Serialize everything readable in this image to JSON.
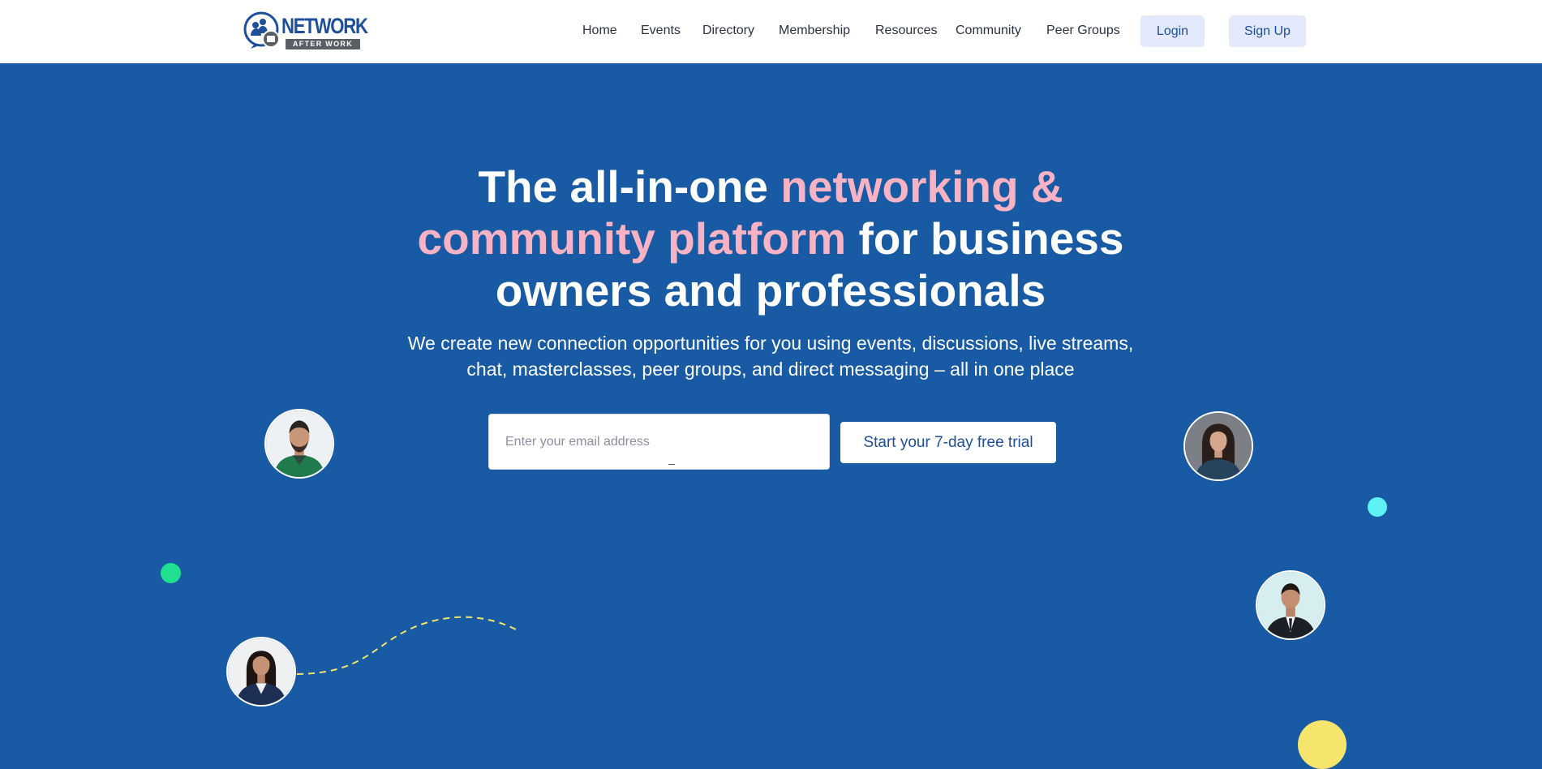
{
  "header": {
    "logo": {
      "name": "logo-network-after-work",
      "word": "NETWORK",
      "sub": "AFTER WORK"
    },
    "nav": [
      {
        "label": "Home"
      },
      {
        "label": "Events"
      },
      {
        "label": "Directory"
      },
      {
        "label": "Membership"
      },
      {
        "label": "Resources"
      },
      {
        "label": "Community"
      },
      {
        "label": "Peer Groups"
      }
    ],
    "login_label": "Login",
    "signup_label": "Sign Up"
  },
  "hero": {
    "title_part1": "The all-in-one ",
    "title_accent": "networking & community platform",
    "title_part2": " for business owners and professionals",
    "subtitle": "We create new connection opportunities for you using events, discussions, live streams, chat, masterclasses, peer groups, and direct messaging – all in one place",
    "email_placeholder": "Enter your email address",
    "email_value": "",
    "cta_label": "Start your 7-day free trial"
  },
  "colors": {
    "hero_bg": "#185aa3",
    "accent_pink": "#f7b2c4",
    "brand_blue": "#1d4f9a",
    "dot_green": "#1ee08f",
    "dot_cyan": "#5ff2f5",
    "dot_yellow": "#f5e56d",
    "dash_yellow": "#f2e36a"
  },
  "decor": {
    "avatars": [
      {
        "name": "avatar-man-green-sweater"
      },
      {
        "name": "avatar-woman-dark-top"
      },
      {
        "name": "avatar-man-suit"
      },
      {
        "name": "avatar-woman-blazer"
      }
    ]
  }
}
